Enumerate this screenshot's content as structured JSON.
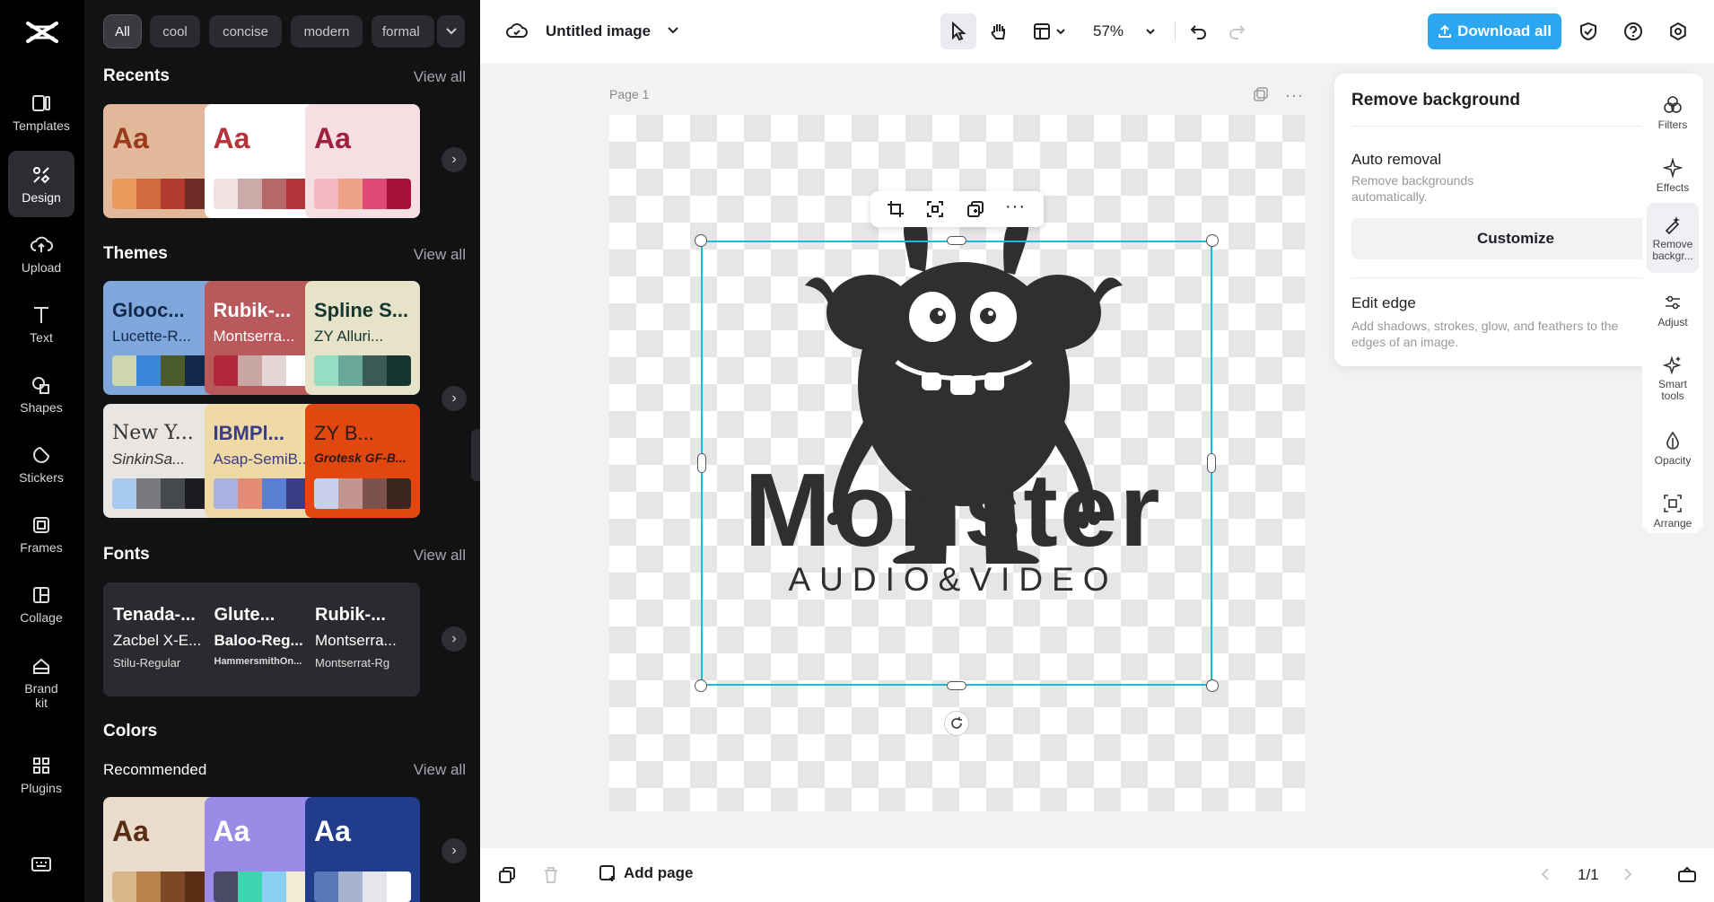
{
  "rail": {
    "items": [
      {
        "label": "Templates",
        "icon": "templates-icon"
      },
      {
        "label": "Design",
        "icon": "design-icon",
        "active": true
      },
      {
        "label": "Upload",
        "icon": "upload-icon"
      },
      {
        "label": "Text",
        "icon": "text-icon"
      },
      {
        "label": "Shapes",
        "icon": "shapes-icon"
      },
      {
        "label": "Stickers",
        "icon": "stickers-icon"
      },
      {
        "label": "Frames",
        "icon": "frames-icon"
      },
      {
        "label": "Collage",
        "icon": "collage-icon"
      },
      {
        "label": "Brand kit",
        "icon": "brand-kit-icon"
      },
      {
        "label": "Plugins",
        "icon": "plugins-icon"
      }
    ]
  },
  "panel": {
    "filters": [
      "All",
      "cool",
      "concise",
      "modern",
      "formal"
    ],
    "recents": {
      "title": "Recents",
      "view_all": "View all",
      "cards": [
        {
          "aa": "Aa",
          "bg": "#e2b89b",
          "fg": "#9b3a1e",
          "colors": [
            "#e89a5c",
            "#d16a3c",
            "#b23a2e",
            "#6f2b25"
          ]
        },
        {
          "aa": "Aa",
          "bg": "#ffffff",
          "fg": "#b4343a",
          "colors": [
            "#efe2e0",
            "#ccaaa7",
            "#b6676a",
            "#b4343a"
          ]
        },
        {
          "aa": "Aa",
          "bg": "#f5dfe2",
          "fg": "#a02040",
          "colors": [
            "#f5b9c4",
            "#eca088",
            "#e04a78",
            "#a8103c"
          ]
        }
      ]
    },
    "themes": {
      "title": "Themes",
      "view_all": "View all",
      "cards": [
        {
          "t1": "Glooc...",
          "t2": "Lucette-R...",
          "bg": "#7fa7dc",
          "fg": "#13294b",
          "colors": [
            "#cdd6ac",
            "#3a86d8",
            "#4a5a2c",
            "#13294b"
          ]
        },
        {
          "t1": "Rubik-...",
          "t2": "Montserra...",
          "bg": "#b9595b",
          "fg": "#ffffff",
          "colors": [
            "#b0283a",
            "#c8a6a4",
            "#e5d7d6",
            "#ffffff"
          ]
        },
        {
          "t1": "Spline S...",
          "t2": "ZY Alluri...",
          "bg": "#e7e3c9",
          "fg": "#15362f",
          "colors": [
            "#96ddc3",
            "#6aa898",
            "#3c5a54",
            "#15362f"
          ]
        },
        {
          "t1": "New Y...",
          "t2": "SinkinSa...",
          "bg": "#e9e5e2",
          "fg": "#333333",
          "colors": [
            "#a8c9ee",
            "#77797e",
            "#45484d",
            "#1b1d20"
          ]
        },
        {
          "t1": "IBMPl...",
          "t2": "Asap-SemiB...",
          "bg": "#efd9a4",
          "fg": "#3a3c86",
          "colors": [
            "#a9b1e0",
            "#e48c78",
            "#5b7fd2",
            "#3a3c86"
          ]
        },
        {
          "t1": "ZY B...",
          "t2": "Grotesk GF-B...",
          "bg": "#e2470f",
          "fg": "#2d1a14",
          "colors": [
            "#c9cfef",
            "#c1948e",
            "#7d524a",
            "#3b261f"
          ]
        }
      ]
    },
    "fonts": {
      "title": "Fonts",
      "view_all": "View all",
      "cards": [
        {
          "f1": "Tenada-...",
          "f2": "Zacbel X-E...",
          "f3": "Stilu-Regular"
        },
        {
          "f1": "Glute...",
          "f2": "Baloo-Reg...",
          "f3": "HammersmithOn..."
        },
        {
          "f1": "Rubik-...",
          "f2": "Montserra...",
          "f3": "Montserrat-Rg"
        }
      ]
    },
    "colors": {
      "title": "Colors",
      "recommended": "Recommended",
      "view_all": "View all",
      "cards": [
        {
          "aa": "Aa",
          "bg": "#eadccb",
          "fg": "#5a2e14",
          "colors": [
            "#d9b68a",
            "#b8824b",
            "#7c4826",
            "#5a2e14"
          ]
        },
        {
          "aa": "Aa",
          "bg": "#9b8ae6",
          "fg": "#ffffff",
          "colors": [
            "#4a4a66",
            "#3dd6b0",
            "#8ad0f5",
            "#f0ecd6"
          ]
        },
        {
          "aa": "Aa",
          "bg": "#223c8c",
          "fg": "#ffffff",
          "colors": [
            "#5a78b8",
            "#a6b4d2",
            "#e4e6ea",
            "#ffffff"
          ]
        }
      ]
    }
  },
  "topbar": {
    "title": "Untitled image",
    "zoom": "57%",
    "download": "Download all"
  },
  "canvas": {
    "page_label": "Page 1",
    "logo_title": "Monster",
    "logo_subtitle": "AUDIO&VIDEO"
  },
  "bottombar": {
    "add_page": "Add page",
    "page_count": "1/1"
  },
  "remove_bg": {
    "title": "Remove background",
    "auto_title": "Auto removal",
    "auto_desc": "Remove backgrounds automatically.",
    "auto_on": true,
    "customize": "Customize",
    "edge_title": "Edit edge",
    "edge_desc": "Add shadows, strokes, glow, and feathers to the edges of an image."
  },
  "tools": [
    {
      "label": "Filters",
      "icon": "filters-icon"
    },
    {
      "label": "Effects",
      "icon": "effects-icon"
    },
    {
      "label": "Remove backgr...",
      "icon": "remove-background-icon",
      "active": true
    },
    {
      "label": "Adjust",
      "icon": "adjust-icon"
    },
    {
      "label": "Smart tools",
      "icon": "smart-tools-icon"
    },
    {
      "label": "Opacity",
      "icon": "opacity-icon"
    },
    {
      "label": "Arrange",
      "icon": "arrange-icon"
    }
  ],
  "colors": {
    "accent": "#2ba6f1",
    "selection": "#1fb8d6",
    "toggle": "#1fb8d6"
  }
}
